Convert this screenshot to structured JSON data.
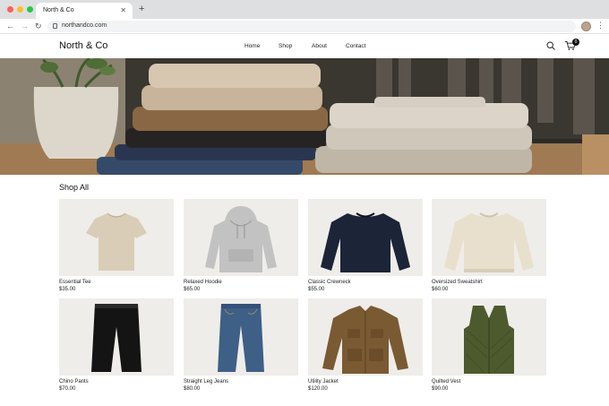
{
  "browser": {
    "tab_title": "North & Co",
    "url": "northandco.com"
  },
  "site": {
    "brand": "North & Co",
    "nav": [
      "Home",
      "Shop",
      "About",
      "Contact"
    ],
    "cart_count": "0"
  },
  "section_title": "Shop All",
  "products": [
    {
      "name": "Essential Tee",
      "price": "$35.00",
      "icon": "tee",
      "color": "#d9cdb8"
    },
    {
      "name": "Relaxed Hoodie",
      "price": "$65.00",
      "icon": "hoodie",
      "color": "#c2c2c2"
    },
    {
      "name": "Classic Crewneck",
      "price": "$55.00",
      "icon": "crewneck",
      "color": "#1c2438"
    },
    {
      "name": "Oversized Sweatshirt",
      "price": "$60.00",
      "icon": "sweatshirt",
      "color": "#e8dfcd"
    },
    {
      "name": "Chino Pants",
      "price": "$70.00",
      "icon": "pants",
      "color": "#141414"
    },
    {
      "name": "Straight Leg Jeans",
      "price": "$80.00",
      "icon": "jeans",
      "color": "#3e5f86"
    },
    {
      "name": "Utility Jacket",
      "price": "$120.00",
      "icon": "jacket",
      "color": "#7a5a32"
    },
    {
      "name": "Quilted Vest",
      "price": "$90.00",
      "icon": "vest",
      "color": "#4c5a2e"
    }
  ]
}
